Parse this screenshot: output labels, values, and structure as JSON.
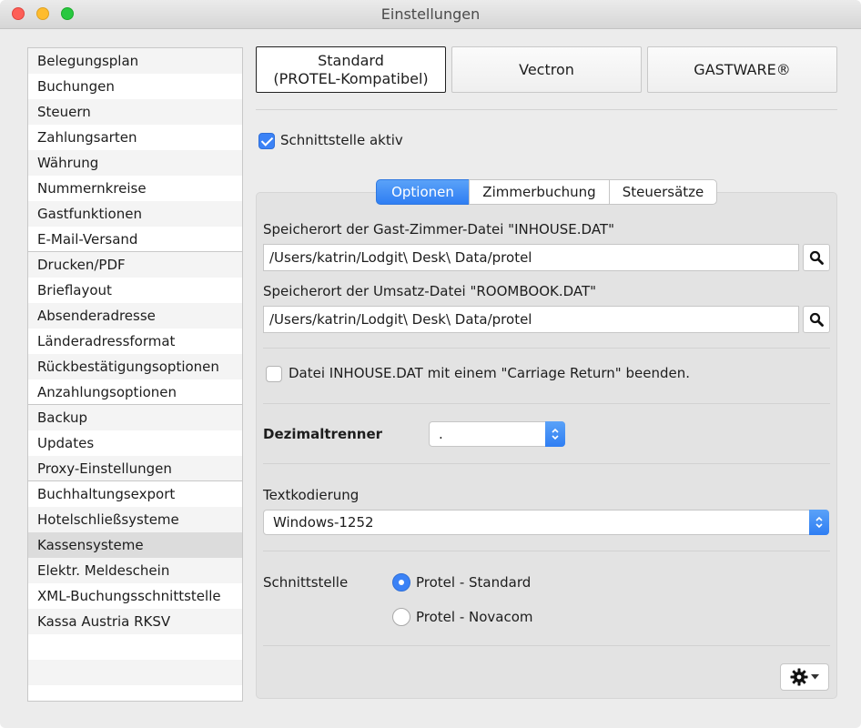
{
  "window": {
    "title": "Einstellungen"
  },
  "sidebar": {
    "items": [
      {
        "label": "Belegungsplan"
      },
      {
        "label": "Buchungen"
      },
      {
        "label": "Steuern"
      },
      {
        "label": "Zahlungsarten"
      },
      {
        "label": "Währung"
      },
      {
        "label": "Nummernkreise"
      },
      {
        "label": "Gastfunktionen"
      },
      {
        "label": "E-Mail-Versand"
      },
      {
        "label": "Drucken/PDF"
      },
      {
        "label": "Brieflayout"
      },
      {
        "label": "Absenderadresse"
      },
      {
        "label": "Länderadressformat"
      },
      {
        "label": "Rückbestätigungsoptionen"
      },
      {
        "label": "Anzahlungsoptionen"
      },
      {
        "label": "Backup"
      },
      {
        "label": "Updates"
      },
      {
        "label": "Proxy-Einstellungen"
      },
      {
        "label": "Buchhaltungsexport"
      },
      {
        "label": "Hotelschließsysteme"
      },
      {
        "label": "Kassensysteme"
      },
      {
        "label": "Elektr. Meldeschein"
      },
      {
        "label": "XML-Buchungsschnittstelle"
      },
      {
        "label": "Kassa Austria RKSV"
      }
    ],
    "selected": "Kassensysteme"
  },
  "systems": {
    "standard_line1": "Standard",
    "standard_line2": "(PROTEL-Kompatibel)",
    "vectron": "Vectron",
    "gastware": "GASTWARE®"
  },
  "interface_active": {
    "label": "Schnittstelle aktiv",
    "checked": true
  },
  "tabs": {
    "options": "Optionen",
    "room_booking": "Zimmerbuchung",
    "tax_rates": "Steuersätze",
    "active": "Optionen"
  },
  "options": {
    "inhouse_label": "Speicherort der Gast-Zimmer-Datei \"INHOUSE.DAT\"",
    "inhouse_path": "/Users/katrin/Lodgit\\ Desk\\ Data/protel",
    "roombook_label": "Speicherort der Umsatz-Datei \"ROOMBOOK.DAT\"",
    "roombook_path": "/Users/katrin/Lodgit\\ Desk\\ Data/protel",
    "carriage_return_label": "Datei INHOUSE.DAT mit einem \"Carriage Return\" beenden.",
    "carriage_return_checked": false,
    "decimal_label": "Dezimaltrenner",
    "decimal_value": ".",
    "encoding_label": "Textkodierung",
    "encoding_value": "Windows-1252",
    "interface_label": "Schnittstelle",
    "interface_options": [
      {
        "label": "Protel - Standard",
        "selected": true
      },
      {
        "label": "Protel - Novacom",
        "selected": false
      }
    ]
  },
  "icons": {
    "search": "magnifier-icon",
    "gear": "gear-icon",
    "dropdown": "chevron-down-icon"
  },
  "colors": {
    "accent": "#3b82f6",
    "selection": "#dcdcdc"
  }
}
